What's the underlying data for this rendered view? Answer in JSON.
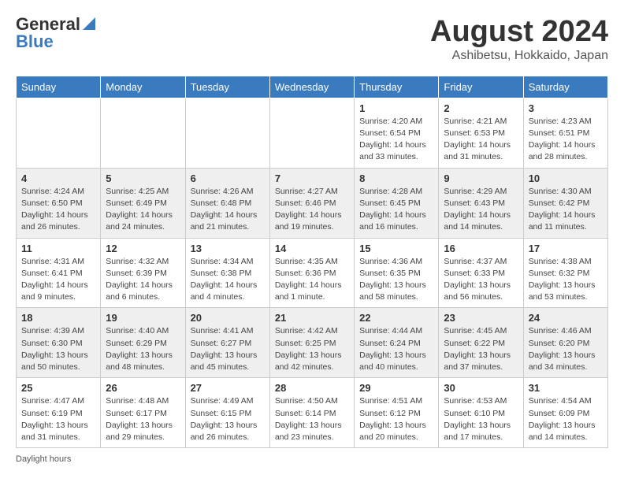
{
  "header": {
    "logo_general": "General",
    "logo_blue": "Blue",
    "title": "August 2024",
    "subtitle": "Ashibetsu, Hokkaido, Japan"
  },
  "days_of_week": [
    "Sunday",
    "Monday",
    "Tuesday",
    "Wednesday",
    "Thursday",
    "Friday",
    "Saturday"
  ],
  "weeks": [
    [
      {
        "day": "",
        "info": ""
      },
      {
        "day": "",
        "info": ""
      },
      {
        "day": "",
        "info": ""
      },
      {
        "day": "",
        "info": ""
      },
      {
        "day": "1",
        "info": "Sunrise: 4:20 AM\nSunset: 6:54 PM\nDaylight: 14 hours and 33 minutes."
      },
      {
        "day": "2",
        "info": "Sunrise: 4:21 AM\nSunset: 6:53 PM\nDaylight: 14 hours and 31 minutes."
      },
      {
        "day": "3",
        "info": "Sunrise: 4:23 AM\nSunset: 6:51 PM\nDaylight: 14 hours and 28 minutes."
      }
    ],
    [
      {
        "day": "4",
        "info": "Sunrise: 4:24 AM\nSunset: 6:50 PM\nDaylight: 14 hours and 26 minutes."
      },
      {
        "day": "5",
        "info": "Sunrise: 4:25 AM\nSunset: 6:49 PM\nDaylight: 14 hours and 24 minutes."
      },
      {
        "day": "6",
        "info": "Sunrise: 4:26 AM\nSunset: 6:48 PM\nDaylight: 14 hours and 21 minutes."
      },
      {
        "day": "7",
        "info": "Sunrise: 4:27 AM\nSunset: 6:46 PM\nDaylight: 14 hours and 19 minutes."
      },
      {
        "day": "8",
        "info": "Sunrise: 4:28 AM\nSunset: 6:45 PM\nDaylight: 14 hours and 16 minutes."
      },
      {
        "day": "9",
        "info": "Sunrise: 4:29 AM\nSunset: 6:43 PM\nDaylight: 14 hours and 14 minutes."
      },
      {
        "day": "10",
        "info": "Sunrise: 4:30 AM\nSunset: 6:42 PM\nDaylight: 14 hours and 11 minutes."
      }
    ],
    [
      {
        "day": "11",
        "info": "Sunrise: 4:31 AM\nSunset: 6:41 PM\nDaylight: 14 hours and 9 minutes."
      },
      {
        "day": "12",
        "info": "Sunrise: 4:32 AM\nSunset: 6:39 PM\nDaylight: 14 hours and 6 minutes."
      },
      {
        "day": "13",
        "info": "Sunrise: 4:34 AM\nSunset: 6:38 PM\nDaylight: 14 hours and 4 minutes."
      },
      {
        "day": "14",
        "info": "Sunrise: 4:35 AM\nSunset: 6:36 PM\nDaylight: 14 hours and 1 minute."
      },
      {
        "day": "15",
        "info": "Sunrise: 4:36 AM\nSunset: 6:35 PM\nDaylight: 13 hours and 58 minutes."
      },
      {
        "day": "16",
        "info": "Sunrise: 4:37 AM\nSunset: 6:33 PM\nDaylight: 13 hours and 56 minutes."
      },
      {
        "day": "17",
        "info": "Sunrise: 4:38 AM\nSunset: 6:32 PM\nDaylight: 13 hours and 53 minutes."
      }
    ],
    [
      {
        "day": "18",
        "info": "Sunrise: 4:39 AM\nSunset: 6:30 PM\nDaylight: 13 hours and 50 minutes."
      },
      {
        "day": "19",
        "info": "Sunrise: 4:40 AM\nSunset: 6:29 PM\nDaylight: 13 hours and 48 minutes."
      },
      {
        "day": "20",
        "info": "Sunrise: 4:41 AM\nSunset: 6:27 PM\nDaylight: 13 hours and 45 minutes."
      },
      {
        "day": "21",
        "info": "Sunrise: 4:42 AM\nSunset: 6:25 PM\nDaylight: 13 hours and 42 minutes."
      },
      {
        "day": "22",
        "info": "Sunrise: 4:44 AM\nSunset: 6:24 PM\nDaylight: 13 hours and 40 minutes."
      },
      {
        "day": "23",
        "info": "Sunrise: 4:45 AM\nSunset: 6:22 PM\nDaylight: 13 hours and 37 minutes."
      },
      {
        "day": "24",
        "info": "Sunrise: 4:46 AM\nSunset: 6:20 PM\nDaylight: 13 hours and 34 minutes."
      }
    ],
    [
      {
        "day": "25",
        "info": "Sunrise: 4:47 AM\nSunset: 6:19 PM\nDaylight: 13 hours and 31 minutes."
      },
      {
        "day": "26",
        "info": "Sunrise: 4:48 AM\nSunset: 6:17 PM\nDaylight: 13 hours and 29 minutes."
      },
      {
        "day": "27",
        "info": "Sunrise: 4:49 AM\nSunset: 6:15 PM\nDaylight: 13 hours and 26 minutes."
      },
      {
        "day": "28",
        "info": "Sunrise: 4:50 AM\nSunset: 6:14 PM\nDaylight: 13 hours and 23 minutes."
      },
      {
        "day": "29",
        "info": "Sunrise: 4:51 AM\nSunset: 6:12 PM\nDaylight: 13 hours and 20 minutes."
      },
      {
        "day": "30",
        "info": "Sunrise: 4:53 AM\nSunset: 6:10 PM\nDaylight: 13 hours and 17 minutes."
      },
      {
        "day": "31",
        "info": "Sunrise: 4:54 AM\nSunset: 6:09 PM\nDaylight: 13 hours and 14 minutes."
      }
    ]
  ],
  "footer": {
    "note": "Daylight hours"
  }
}
